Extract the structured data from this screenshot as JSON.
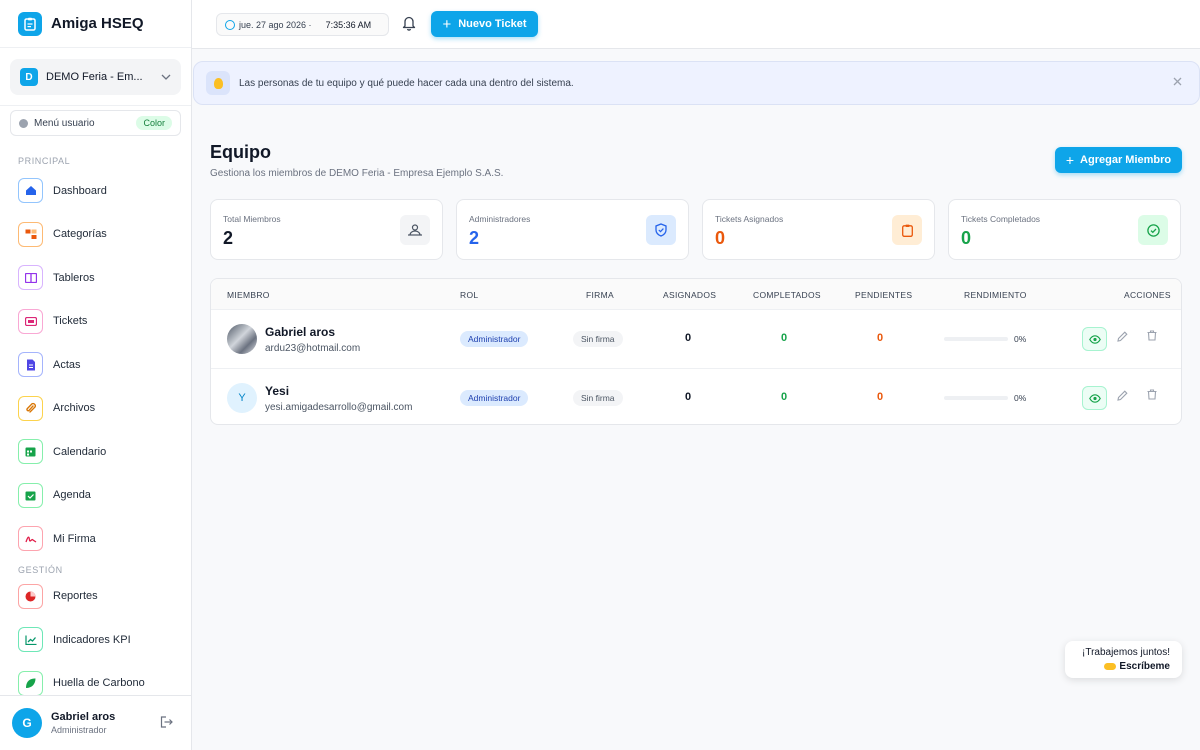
{
  "app": {
    "name": "Amiga HSEQ"
  },
  "org": {
    "badge": "D",
    "name": "DEMO Feria - Em..."
  },
  "menu_user": {
    "label": "Menú usuario",
    "badge": "Color"
  },
  "sections": {
    "principal": "PRINCIPAL",
    "gestion": "GESTIÓN"
  },
  "nav": [
    {
      "label": "Dashboard",
      "icon": "home-icon",
      "color": "#2563eb"
    },
    {
      "label": "Categorías",
      "icon": "hierarchy-icon",
      "color": "#ea580c"
    },
    {
      "label": "Tableros",
      "icon": "board-icon",
      "color": "#9333ea"
    },
    {
      "label": "Tickets",
      "icon": "ticket-icon",
      "color": "#db2777"
    },
    {
      "label": "Actas",
      "icon": "document-icon",
      "color": "#4f46e5"
    },
    {
      "label": "Archivos",
      "icon": "paperclip-icon",
      "color": "#d97706"
    },
    {
      "label": "Calendario",
      "icon": "calendar-icon",
      "color": "#16a34a"
    },
    {
      "label": "Agenda",
      "icon": "agenda-icon",
      "color": "#16a34a"
    },
    {
      "label": "Mi Firma",
      "icon": "signature-icon",
      "color": "#e11d48"
    },
    {
      "label": "Reportes",
      "icon": "pie-chart-icon",
      "color": "#dc2626"
    },
    {
      "label": "Indicadores KPI",
      "icon": "trend-icon",
      "color": "#059669"
    },
    {
      "label": "Huella de Carbono",
      "icon": "leaf-icon",
      "color": "#16a34a"
    }
  ],
  "footer_user": {
    "initial": "G",
    "name": "Gabriel aros",
    "role": "Administrador"
  },
  "topbar": {
    "date": "jue. 27 ago 2026 ·",
    "time": "7:35:36 AM",
    "new_ticket": "Nuevo Ticket"
  },
  "banner": {
    "text": "Las personas de tu equipo y qué puede hacer cada una dentro del sistema."
  },
  "page": {
    "title": "Equipo",
    "subtitle": "Gestiona los miembros de DEMO Feria - Empresa Ejemplo S.A.S.",
    "add_member": "Agregar Miembro"
  },
  "stats": [
    {
      "label": "Total Miembros",
      "value": "2",
      "color": "#111827",
      "icon": "team-icon",
      "icon_bg": "#f3f4f6"
    },
    {
      "label": "Administradores",
      "value": "2",
      "color": "#2563eb",
      "icon": "shield-icon",
      "icon_bg": "#dbeafe"
    },
    {
      "label": "Tickets Asignados",
      "value": "0",
      "color": "#ea580c",
      "icon": "clipboard-icon",
      "icon_bg": "#ffedd5"
    },
    {
      "label": "Tickets Completados",
      "value": "0",
      "color": "#16a34a",
      "icon": "check-circle-icon",
      "icon_bg": "#dcfce7"
    }
  ],
  "table": {
    "headers": [
      "MIEMBRO",
      "ROL",
      "FIRMA",
      "ASIGNADOS",
      "COMPLETADOS",
      "PENDIENTES",
      "RENDIMIENTO",
      "ACCIONES"
    ],
    "rows": [
      {
        "name": "Gabriel aros",
        "email": "ardu23@hotmail.com",
        "role": "Administrador",
        "signature": "Sin firma",
        "assigned": "0",
        "completed": "0",
        "pending": "0",
        "performance": "0%",
        "performance_value": 0
      },
      {
        "initial": "Y",
        "name": "Yesi",
        "email": "yesi.amigadesarrollo@gmail.com",
        "role": "Administrador",
        "signature": "Sin firma",
        "assigned": "0",
        "completed": "0",
        "pending": "0",
        "performance": "0%",
        "performance_value": 0
      }
    ]
  },
  "bubble": {
    "line1": "¡Trabajemos juntos!",
    "line2": "Escríbeme"
  },
  "colors": {
    "accent": "#0ea5e9",
    "completed": "#16a34a",
    "pending": "#ea580c"
  }
}
